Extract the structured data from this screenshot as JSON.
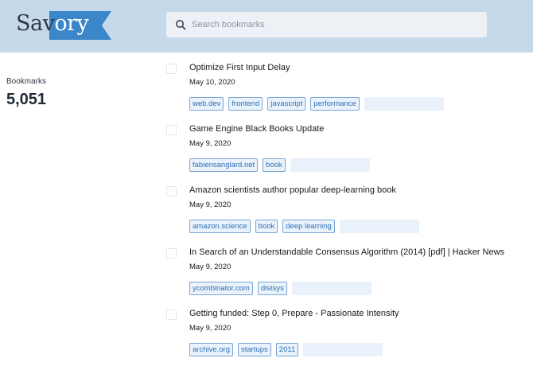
{
  "app": {
    "logo_part1": "Sav",
    "logo_part2": "ory",
    "brand_color": "#3a86c8",
    "header_color": "#c6d9eb"
  },
  "search": {
    "placeholder": "Search bookmarks",
    "value": ""
  },
  "stats": {
    "label": "Bookmarks",
    "count": "5,051"
  },
  "bookmarks": [
    {
      "title": "Optimize First Input Delay",
      "date": "May 10, 2020",
      "tags": [
        "web.dev",
        "frontend",
        "javascript",
        "performance"
      ]
    },
    {
      "title": "Game Engine Black Books Update",
      "date": "May 9, 2020",
      "tags": [
        "fabiensanglard.net",
        "book"
      ]
    },
    {
      "title": "Amazon scientists author popular deep-learning book",
      "date": "May 9, 2020",
      "tags": [
        "amazon.science",
        "book",
        "deep learning"
      ]
    },
    {
      "title": "In Search of an Understandable Consensus Algorithm (2014) [pdf] | Hacker News",
      "date": "May 9, 2020",
      "tags": [
        "ycombinator.com",
        "distsys"
      ]
    },
    {
      "title": "Getting funded: Step 0, Prepare - Passionate Intensity",
      "date": "May 9, 2020",
      "tags": [
        "archive.org",
        "startups",
        "2011"
      ]
    }
  ]
}
